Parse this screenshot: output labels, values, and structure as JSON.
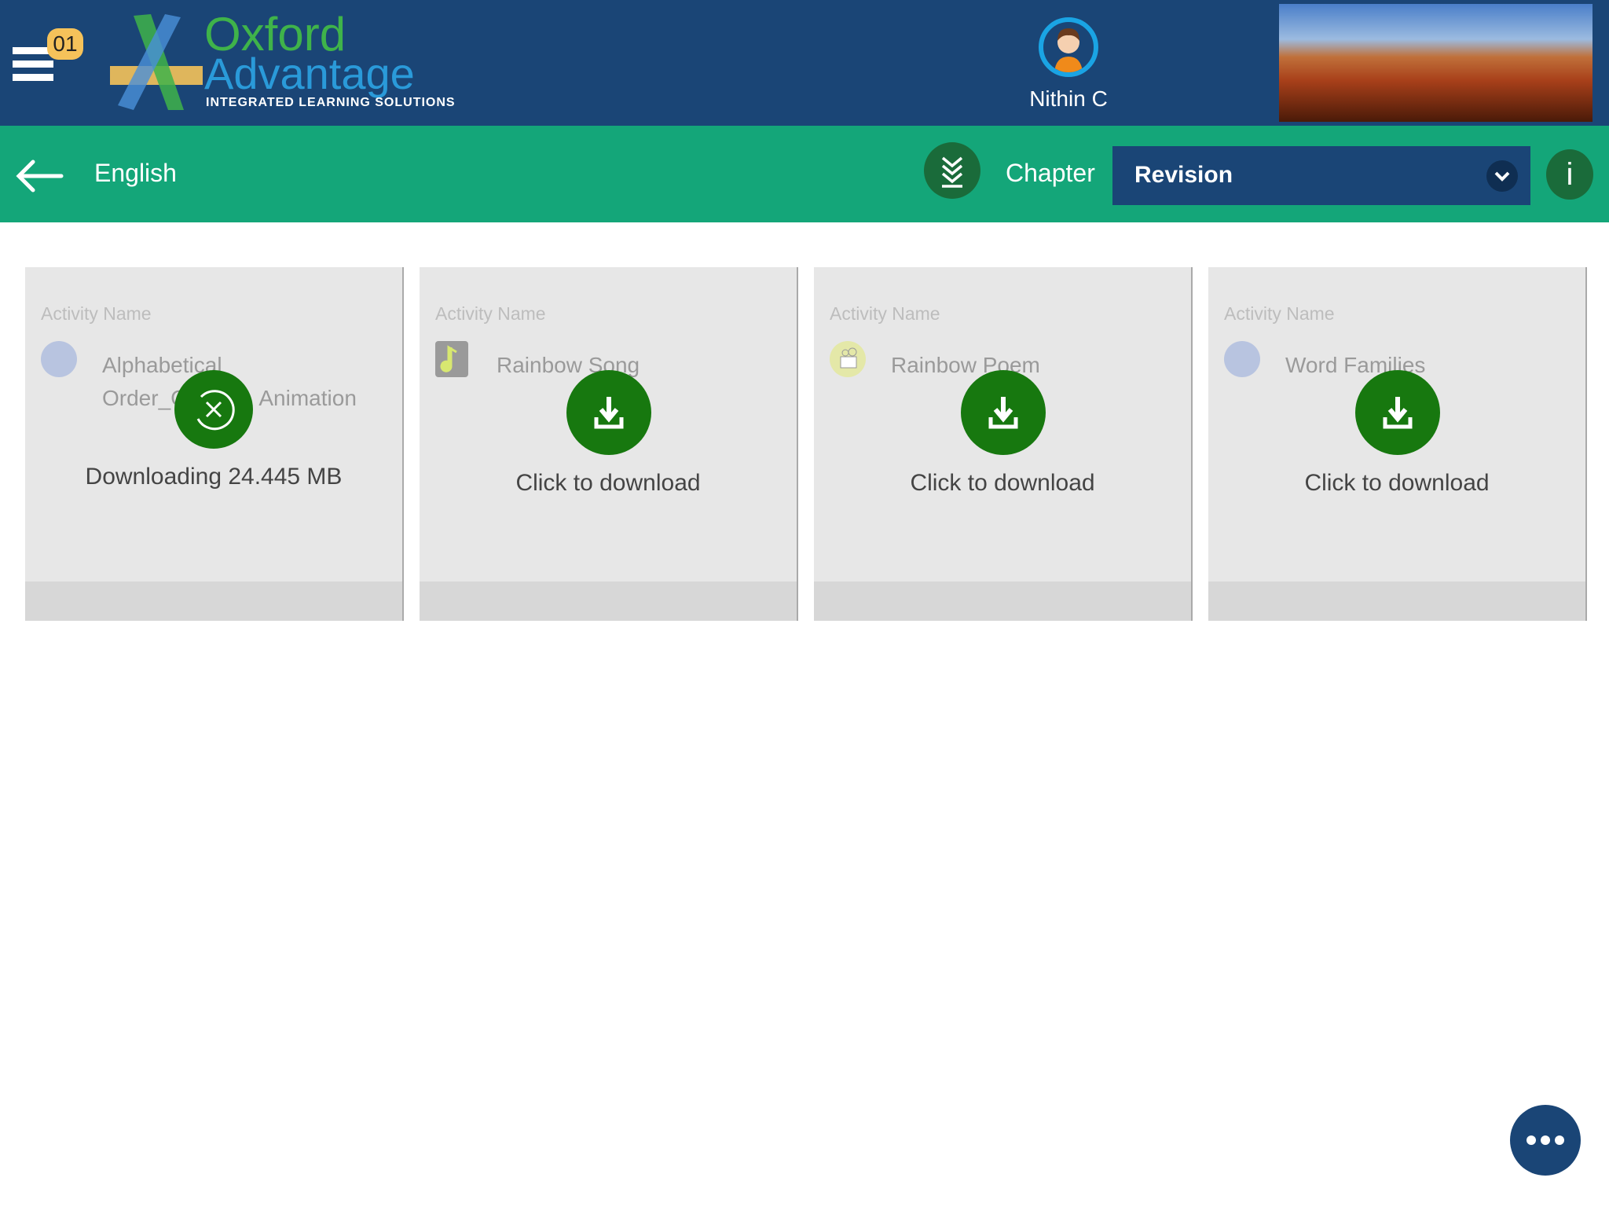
{
  "header": {
    "menu_badge": "01",
    "logo": {
      "line1": "Oxford",
      "line2": "Advantage",
      "tagline": "INTEGRATED LEARNING SOLUTIONS"
    },
    "user_name": "Nithin C"
  },
  "subbar": {
    "subject": "English",
    "chapter_label": "Chapter",
    "chapter_selected": "Revision",
    "info_label": "i"
  },
  "cards": [
    {
      "label": "Activity Name",
      "name": "Alphabetical Order_Catchy Animation",
      "name_visible_line1": "Alphabetical",
      "name_visible_line2a": "Order_C",
      "name_visible_line2b": "Animation",
      "status": "Downloading 24.445 MB",
      "icon": "animation-icon",
      "state": "downloading"
    },
    {
      "label": "Activity Name",
      "name": "Rainbow Song",
      "status": "Click to download",
      "icon": "music-icon",
      "state": "not-downloaded"
    },
    {
      "label": "Activity Name",
      "name": "Rainbow Poem",
      "status": "Click to download",
      "icon": "video-camera-icon",
      "state": "not-downloaded"
    },
    {
      "label": "Activity Name",
      "name": "Word Families",
      "status": "Click to download",
      "icon": "animation-icon",
      "state": "not-downloaded"
    }
  ],
  "colors": {
    "header": "#1a4576",
    "subbar": "#14a679",
    "button_green": "#17780f",
    "card": "#e7e7e7"
  }
}
